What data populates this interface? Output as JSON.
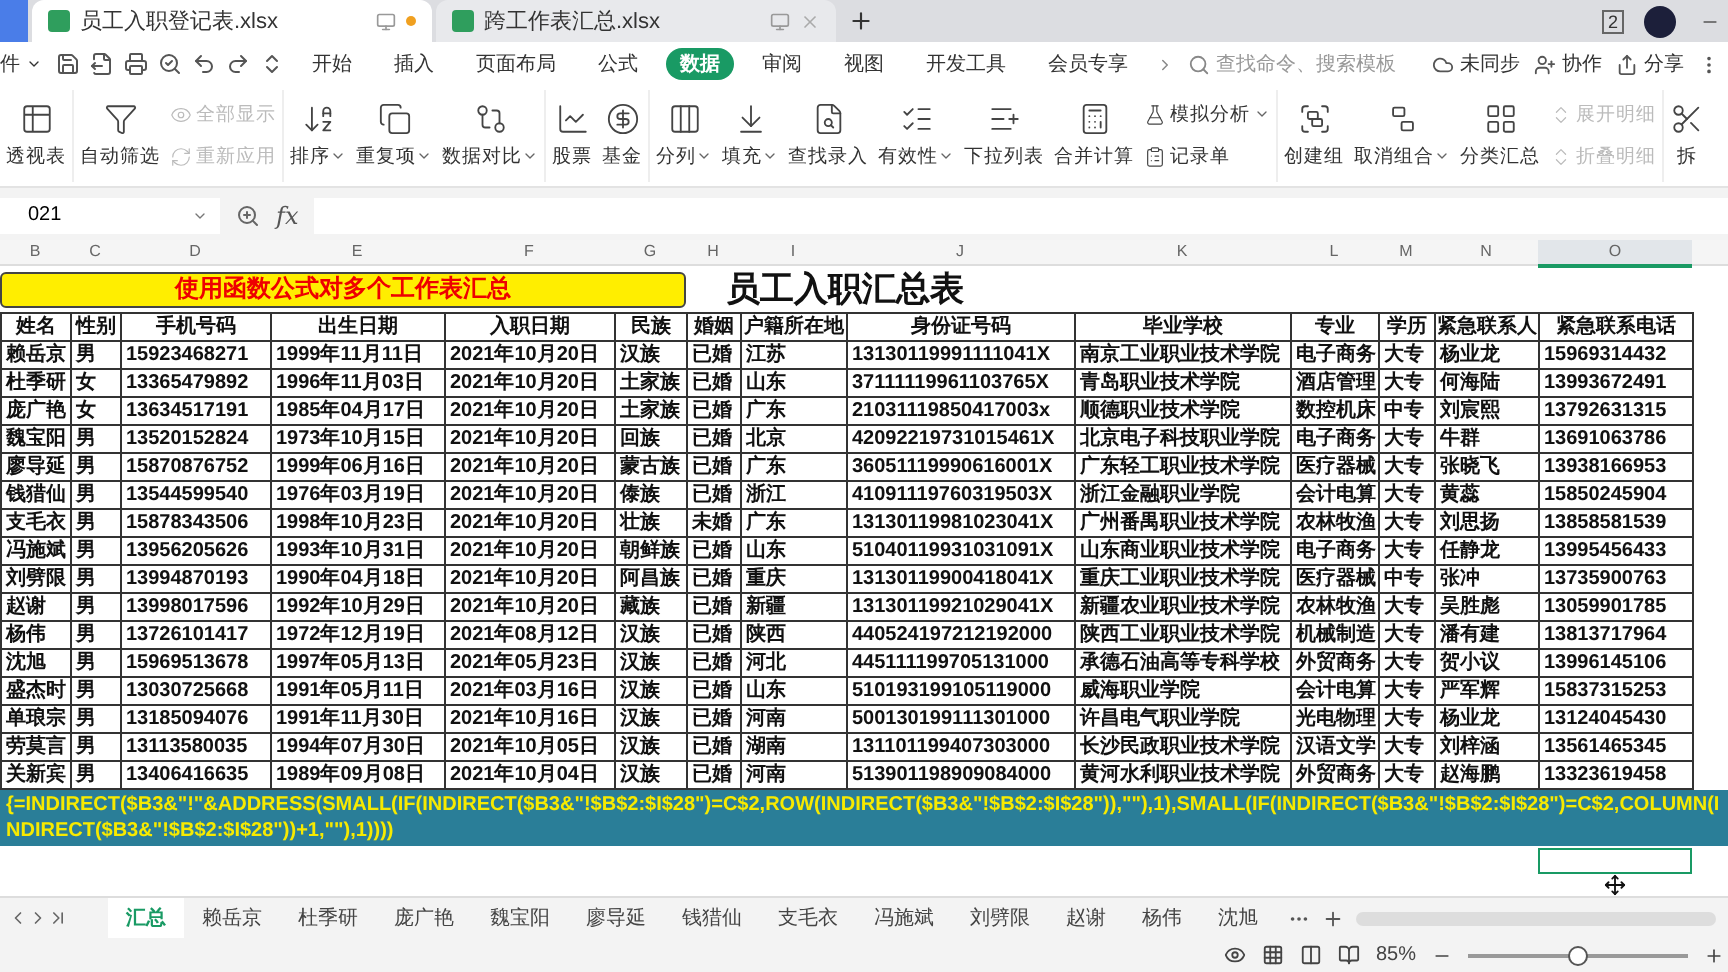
{
  "doc_tabs": [
    {
      "title": "员工入职登记表.xlsx",
      "selected": true,
      "modified": true
    },
    {
      "title": "跨工作表汇总.xlsx",
      "selected": false,
      "modified": false
    }
  ],
  "window_badge": "2",
  "menu": {
    "file": "件",
    "tabs": [
      {
        "label": "开始",
        "selected": false
      },
      {
        "label": "插入",
        "selected": false
      },
      {
        "label": "页面布局",
        "selected": false
      },
      {
        "label": "公式",
        "selected": false
      },
      {
        "label": "数据",
        "selected": true
      },
      {
        "label": "审阅",
        "selected": false
      },
      {
        "label": "视图",
        "selected": false
      },
      {
        "label": "开发工具",
        "selected": false
      },
      {
        "label": "会员专享",
        "selected": false
      }
    ],
    "search_placeholder": "查找命令、搜索模板",
    "actions": [
      "未同步",
      "协作",
      "分享"
    ]
  },
  "ribbon": [
    [
      {
        "kind": "large",
        "label": "透视表",
        "dropdown": false
      }
    ],
    [
      {
        "kind": "large",
        "label": "自动筛选",
        "dropdown": false
      },
      {
        "kind": "stack",
        "items": [
          {
            "label": "全部显示",
            "disabled": true,
            "dropdown": false
          },
          {
            "label": "重新应用",
            "disabled": true,
            "dropdown": false
          }
        ]
      }
    ],
    [
      {
        "kind": "large",
        "label": "排序",
        "dropdown": true
      },
      {
        "kind": "large",
        "label": "重复项",
        "dropdown": true
      },
      {
        "kind": "large",
        "label": "数据对比",
        "dropdown": true
      }
    ],
    [
      {
        "kind": "large",
        "label": "股票",
        "dropdown": false
      },
      {
        "kind": "large",
        "label": "基金",
        "dropdown": false
      }
    ],
    [
      {
        "kind": "large",
        "label": "分列",
        "dropdown": true
      },
      {
        "kind": "large",
        "label": "填充",
        "dropdown": true
      },
      {
        "kind": "large",
        "label": "查找录入",
        "dropdown": false
      },
      {
        "kind": "large",
        "label": "有效性",
        "dropdown": true
      },
      {
        "kind": "large",
        "label": "下拉列表",
        "dropdown": false
      },
      {
        "kind": "large",
        "label": "合并计算",
        "dropdown": false
      },
      {
        "kind": "stack",
        "items": [
          {
            "label": "模拟分析",
            "disabled": false,
            "dropdown": true
          },
          {
            "label": "记录单",
            "disabled": false,
            "dropdown": false
          }
        ]
      }
    ],
    [
      {
        "kind": "large",
        "label": "创建组",
        "dropdown": false
      },
      {
        "kind": "large",
        "label": "取消组合",
        "dropdown": true
      },
      {
        "kind": "large",
        "label": "分类汇总",
        "dropdown": false
      },
      {
        "kind": "stack",
        "items": [
          {
            "label": "展开明细",
            "disabled": true,
            "dropdown": false
          },
          {
            "label": "折叠明细",
            "disabled": true,
            "dropdown": false
          }
        ]
      }
    ],
    [
      {
        "kind": "large",
        "label": "拆",
        "dropdown": false
      }
    ]
  ],
  "formula_bar": {
    "name_box": "021",
    "fx": "fx"
  },
  "columns": [
    {
      "label": "B",
      "selected": false
    },
    {
      "label": "C",
      "selected": false
    },
    {
      "label": "D",
      "selected": false
    },
    {
      "label": "E",
      "selected": false
    },
    {
      "label": "F",
      "selected": false
    },
    {
      "label": "G",
      "selected": false
    },
    {
      "label": "H",
      "selected": false
    },
    {
      "label": "I",
      "selected": false
    },
    {
      "label": "J",
      "selected": false
    },
    {
      "label": "K",
      "selected": false
    },
    {
      "label": "L",
      "selected": false
    },
    {
      "label": "M",
      "selected": false
    },
    {
      "label": "N",
      "selected": false
    },
    {
      "label": "O",
      "selected": true
    }
  ],
  "banner": "使用函数公式对多个工作表汇总",
  "title": "员工入职汇总表",
  "headers": [
    "姓名",
    "性别",
    "手机号码",
    "出生日期",
    "入职日期",
    "民族",
    "婚姻",
    "户籍所在地",
    "身份证号码",
    "毕业学校",
    "专业",
    "学历",
    "紧急联系人",
    "紧急联系电话"
  ],
  "rows": [
    [
      "赖岳京",
      "男",
      "15923468271",
      "1999年11月11日",
      "2021年10月20日",
      "汉族",
      "已婚",
      "江苏",
      "13130119991111041X",
      "南京工业职业技术学院",
      "电子商务",
      "大专",
      "杨业龙",
      "15969314432"
    ],
    [
      "杜季研",
      "女",
      "13365479892",
      "1996年11月03日",
      "2021年10月20日",
      "土家族",
      "已婚",
      "山东",
      "37111119961103765X",
      "青岛职业技术学院",
      "酒店管理",
      "大专",
      "何海陆",
      "13993672491"
    ],
    [
      "庞广艳",
      "女",
      "13634517191",
      "1985年04月17日",
      "2021年10月20日",
      "土家族",
      "已婚",
      "广东",
      "21031119850417003x",
      "顺德职业技术学院",
      "数控机床",
      "中专",
      "刘宸熙",
      "13792631315"
    ],
    [
      "魏宝阳",
      "男",
      "13520152824",
      "1973年10月15日",
      "2021年10月20日",
      "回族",
      "已婚",
      "北京",
      "42092219731015461X",
      "北京电子科技职业学院",
      "电子商务",
      "大专",
      "牛群",
      "13691063786"
    ],
    [
      "廖导延",
      "男",
      "15870876752",
      "1999年06月16日",
      "2021年10月20日",
      "蒙古族",
      "已婚",
      "广东",
      "36051119990616001X",
      "广东轻工职业技术学院",
      "医疗器械",
      "大专",
      "张晓飞",
      "13938166953"
    ],
    [
      "钱猎仙",
      "男",
      "13544599540",
      "1976年03月19日",
      "2021年10月20日",
      "傣族",
      "已婚",
      "浙江",
      "41091119760319503X",
      "浙江金融职业学院",
      "会计电算",
      "大专",
      "黄蕊",
      "15850245904"
    ],
    [
      "支毛衣",
      "男",
      "15878343506",
      "1998年10月23日",
      "2021年10月20日",
      "壮族",
      "未婚",
      "广东",
      "13130119981023041X",
      "广州番禺职业技术学院",
      "农林牧渔",
      "大专",
      "刘思扬",
      "13858581539"
    ],
    [
      "冯施斌",
      "男",
      "13956205626",
      "1993年10月31日",
      "2021年10月20日",
      "朝鲜族",
      "已婚",
      "山东",
      "51040119931031091X",
      "山东商业职业技术学院",
      "电子商务",
      "大专",
      "任静龙",
      "13995456433"
    ],
    [
      "刘劈限",
      "男",
      "13994870193",
      "1990年04月18日",
      "2021年10月20日",
      "阿昌族",
      "已婚",
      "重庆",
      "13130119900418041X",
      "重庆工业职业技术学院",
      "医疗器械",
      "中专",
      "张冲",
      "13735900763"
    ],
    [
      "赵谢",
      "男",
      "13998017596",
      "1992年10月29日",
      "2021年10月20日",
      "藏族",
      "已婚",
      "新疆",
      "13130119921029041X",
      "新疆农业职业技术学院",
      "农林牧渔",
      "大专",
      "吴胜彪",
      "13059901785"
    ],
    [
      "杨伟",
      "男",
      "13726101417",
      "1972年12月19日",
      "2021年08月12日",
      "汉族",
      "已婚",
      "陕西",
      "440524197212192000",
      "陕西工业职业技术学院",
      "机械制造",
      "大专",
      "潘有建",
      "13813717964"
    ],
    [
      "沈旭",
      "男",
      "15969513678",
      "1997年05月13日",
      "2021年05月23日",
      "汉族",
      "已婚",
      "河北",
      "445111199705131000",
      "承德石油高等专科学校",
      "外贸商务",
      "大专",
      "贺小议",
      "13996145106"
    ],
    [
      "盛杰时",
      "男",
      "13030725668",
      "1991年05月11日",
      "2021年03月16日",
      "汉族",
      "已婚",
      "山东",
      "510193199105119000",
      "威海职业学院",
      "会计电算",
      "大专",
      "严军辉",
      "15837315253"
    ],
    [
      "单琅宗",
      "男",
      "13185094076",
      "1991年11月30日",
      "2021年10月16日",
      "汉族",
      "已婚",
      "河南",
      "500130199111301000",
      "许昌电气职业学院",
      "光电物理",
      "大专",
      "杨业龙",
      "13124045430"
    ],
    [
      "劳莫言",
      "男",
      "13113580035",
      "1994年07月30日",
      "2021年10月05日",
      "汉族",
      "已婚",
      "湖南",
      "131101199407303000",
      "长沙民政职业技术学院",
      "汉语文学",
      "大专",
      "刘梓涵",
      "13561465345"
    ],
    [
      "关新宾",
      "男",
      "13406416635",
      "1989年09月08日",
      "2021年10月04日",
      "汉族",
      "已婚",
      "河南",
      "513901198909084000",
      "黄河水利职业技术学院",
      "外贸商务",
      "大专",
      "赵海鹏",
      "13323619458"
    ]
  ],
  "formula_tip": "{=INDIRECT($B3&\"!\"&ADDRESS(SMALL(IF(INDIRECT($B3&\"!$B$2:$I$28\")=C$2,ROW(INDIRECT($B3&\"!$B$2:$I$28\")),\"\"),1),SMALL(IF(INDIRECT($B3&\"!$B$2:$I$28\")=C$2,COLUMN(INDIRECT($B3&\"!$B$2:$I$28\"))+1,\"\"),1))))",
  "sheet_tabs": [
    {
      "label": "汇总",
      "selected": true
    },
    {
      "label": "赖岳京",
      "selected": false
    },
    {
      "label": "杜季研",
      "selected": false
    },
    {
      "label": "庞广艳",
      "selected": false
    },
    {
      "label": "魏宝阳",
      "selected": false
    },
    {
      "label": "廖导延",
      "selected": false
    },
    {
      "label": "钱猎仙",
      "selected": false
    },
    {
      "label": "支毛衣",
      "selected": false
    },
    {
      "label": "冯施斌",
      "selected": false
    },
    {
      "label": "刘劈限",
      "selected": false
    },
    {
      "label": "赵谢",
      "selected": false
    },
    {
      "label": "杨伟",
      "selected": false
    },
    {
      "label": "沈旭",
      "selected": false
    }
  ],
  "status": {
    "zoom": "85%",
    "zoom_slider": {
      "level": 0.5
    }
  }
}
